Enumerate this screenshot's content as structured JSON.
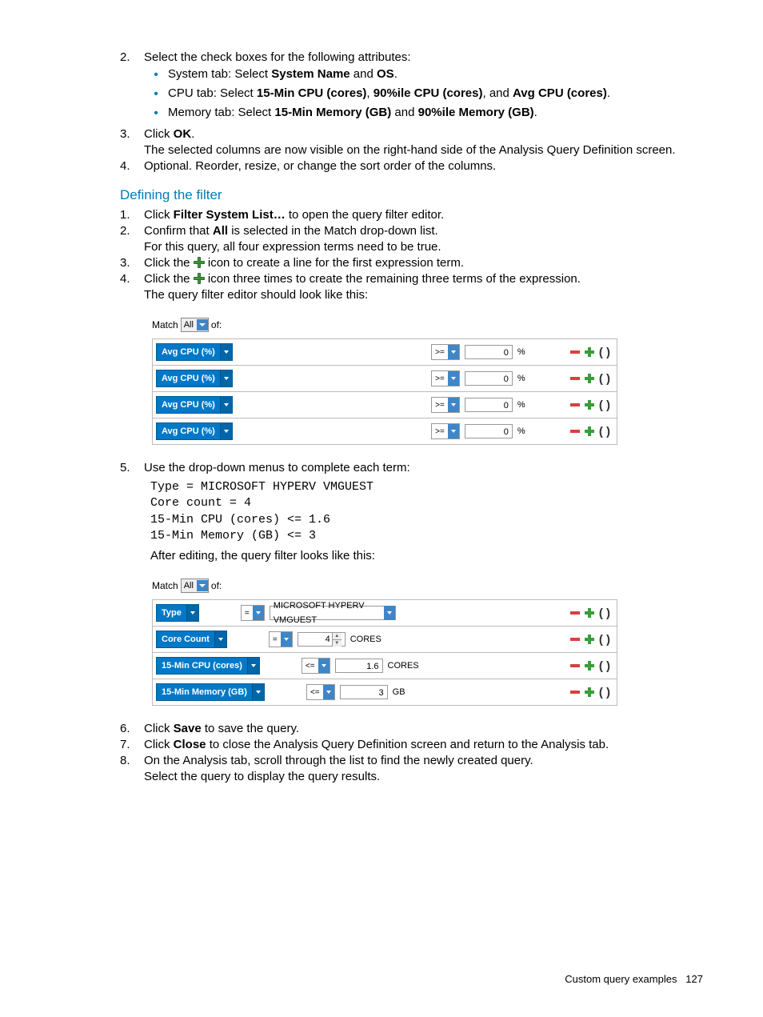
{
  "steps_top": [
    {
      "n": "2.",
      "text_prefix": "Select the check boxes for the following attributes:",
      "bullets": [
        {
          "prefix": "System tab: Select ",
          "b1": "System Name",
          "mid": " and ",
          "b2": "OS",
          "suffix": "."
        },
        {
          "prefix": "CPU tab: Select ",
          "b1": "15-Min CPU (cores)",
          "mid": ", ",
          "b2": "90%ile CPU (cores)",
          "mid2": ", and ",
          "b3": "Avg CPU (cores)",
          "suffix": "."
        },
        {
          "prefix": "Memory tab: Select ",
          "b1": "15-Min Memory (GB)",
          "mid": " and ",
          "b2": "90%ile Memory (GB)",
          "suffix": "."
        }
      ]
    },
    {
      "n": "3.",
      "prefix": "Click ",
      "b1": "OK",
      "suffix": ".",
      "after": "The selected columns are now visible on the right-hand side of the Analysis Query Definition screen."
    },
    {
      "n": "4.",
      "text": "Optional. Reorder, resize, or change the sort order of the columns."
    }
  ],
  "heading": "Defining the filter",
  "steps_def": [
    {
      "n": "1.",
      "prefix": "Click ",
      "b1": "Filter System List…",
      "suffix": " to open the query filter editor."
    },
    {
      "n": "2.",
      "prefix": "Confirm that ",
      "b1": "All",
      "suffix": " is selected in the Match drop-down list.",
      "after": "For this query, all four expression terms need to be true."
    },
    {
      "n": "3.",
      "prefix": "Click the ",
      "suffix": " icon to create a line for the first expression term."
    },
    {
      "n": "4.",
      "prefix": "Click the ",
      "suffix": " icon three times to create the remaining three terms of the expression.",
      "after": "The query filter editor should look like this:"
    }
  ],
  "match_label": "Match",
  "match_value": "All",
  "match_of": "of:",
  "filter1_rows": [
    {
      "field": "Avg CPU (%)",
      "op": ">=",
      "val": "0",
      "unit": "%"
    },
    {
      "field": "Avg CPU (%)",
      "op": ">=",
      "val": "0",
      "unit": "%"
    },
    {
      "field": "Avg CPU (%)",
      "op": ">=",
      "val": "0",
      "unit": "%"
    },
    {
      "field": "Avg CPU (%)",
      "op": ">=",
      "val": "0",
      "unit": "%"
    }
  ],
  "step5": {
    "n": "5.",
    "text": "Use the drop-down menus to complete each term:"
  },
  "code": "Type = MICROSOFT HYPERV VMGUEST\nCore count = 4\n15-Min CPU (cores) <= 1.6\n15-Min Memory (GB) <= 3",
  "after_code": "After editing, the query filter looks like this:",
  "filter2_rows": [
    {
      "field": "Type",
      "op": "=",
      "val": "MICROSOFT HYPERV VMGUEST",
      "unit": "",
      "wide": true,
      "valdd": true
    },
    {
      "field": "Core Count",
      "op": "=",
      "val": "4",
      "unit": "CORES",
      "spinner": true
    },
    {
      "field": "15-Min CPU (cores)",
      "op": "<=",
      "val": "1.6",
      "unit": "CORES"
    },
    {
      "field": "15-Min Memory (GB)",
      "op": "<=",
      "val": "3",
      "unit": "GB"
    }
  ],
  "steps_bottom": [
    {
      "n": "6.",
      "prefix": "Click ",
      "b1": "Save",
      "suffix": " to save the query."
    },
    {
      "n": "7.",
      "prefix": "Click ",
      "b1": "Close",
      "suffix": " to close the Analysis Query Definition screen and return to the Analysis tab."
    },
    {
      "n": "8.",
      "text": "On the Analysis tab, scroll through the list to find the newly created query.",
      "after": "Select the query to display the query results."
    }
  ],
  "footer_text": "Custom query examples",
  "footer_page": "127"
}
